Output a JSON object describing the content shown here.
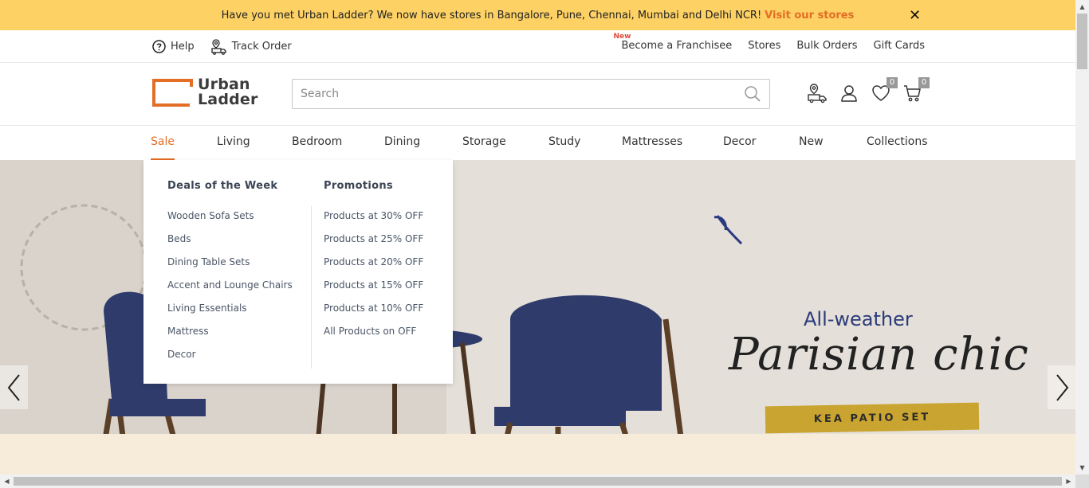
{
  "announcement": {
    "text": "Have you met Urban Ladder? We now have stores in Bangalore, Pune, Chennai, Mumbai and Delhi NCR!",
    "link": "Visit our stores",
    "close": "✕"
  },
  "utility": {
    "left": [
      {
        "label": "Help",
        "icon": "help-circle-icon"
      },
      {
        "label": "Track Order",
        "icon": "track-order-icon"
      }
    ],
    "right": [
      {
        "label": "Become a Franchisee",
        "tag": "New"
      },
      {
        "label": "Stores"
      },
      {
        "label": "Bulk Orders"
      },
      {
        "label": "Gift Cards"
      }
    ]
  },
  "header": {
    "logo_line1": "Urban",
    "logo_line2": "Ladder",
    "search_placeholder": "Search",
    "wishlist_count": "0",
    "cart_count": "0"
  },
  "nav": {
    "items": [
      "Sale",
      "Living",
      "Bedroom",
      "Dining",
      "Storage",
      "Study",
      "Mattresses",
      "Decor",
      "New",
      "Collections"
    ],
    "active": "Sale"
  },
  "mega_menu": {
    "col1_title": "Deals of the Week",
    "col1_links": [
      "Wooden Sofa Sets",
      "Beds",
      "Dining Table Sets",
      "Accent and Lounge Chairs",
      "Living Essentials",
      "Mattress",
      "Decor"
    ],
    "col2_title": "Promotions",
    "col2_links": [
      "Products at 30% OFF",
      "Products at 25% OFF",
      "Products at 20% OFF",
      "Products at 15% OFF",
      "Products at 10% OFF",
      "All Products on OFF"
    ]
  },
  "hero": {
    "title_small": "All-weather",
    "title_big": "Parisian chic",
    "tag": "KEA PATIO SET"
  },
  "colors": {
    "announcement_bg": "#fdd164",
    "accent": "#e36e25",
    "hero_tag": "#c9a431",
    "hero_title_small": "#2b3a7a"
  }
}
